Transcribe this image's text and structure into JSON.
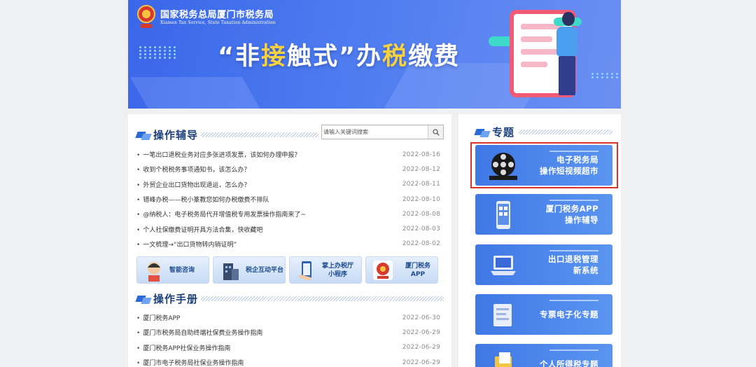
{
  "banner": {
    "org_cn": "国家税务总局厦门市税务局",
    "org_en": "Xiamen Tax Service, State Taxation Administration",
    "headline_pre": "“非",
    "headline_hl": "接",
    "headline_mid": "触式”办",
    "headline_hl2": "税",
    "headline_post": "缴费"
  },
  "guide": {
    "title": "操作辅导",
    "search_placeholder": "请输入关键词搜索",
    "items": [
      {
        "title": "一笔出口退税业务对应多张进项发票，该如何办理申报？",
        "date": "2022-08-16"
      },
      {
        "title": "收到个税税务事项通知书，该怎么办？",
        "date": "2022-08-12"
      },
      {
        "title": "外贸企业出口货物出现退运，怎么办？",
        "date": "2022-08-11"
      },
      {
        "title": "错峰办税——税小篆教您如何办税缴费不排队",
        "date": "2022-08-10"
      },
      {
        "title": "@纳税人：电子税务局代开增值税专用发票操作指南来了~",
        "date": "2022-08-08"
      },
      {
        "title": "个人社保缴费证明开具方法合集，快收藏吧",
        "date": "2022-08-03"
      },
      {
        "title": "一文梳理→“出口货物转内销证明”",
        "date": "2022-08-02"
      }
    ]
  },
  "quick_links": [
    {
      "label": "智能咨询"
    },
    {
      "label": "税企互动平台"
    },
    {
      "label": "掌上办税厅\n小程序"
    },
    {
      "label": "厦门税务APP"
    }
  ],
  "manual": {
    "title": "操作手册",
    "items": [
      {
        "title": "厦门税务APP",
        "date": "2022-06-30"
      },
      {
        "title": "厦门市税务局自助终端社保费业务操作指南",
        "date": "2022-06-29"
      },
      {
        "title": "厦门税务APP社保业务操作指南",
        "date": "2022-06-29"
      },
      {
        "title": "厦门市电子税务局社保业务操作指南",
        "date": "2022-06-29"
      }
    ]
  },
  "topics": {
    "title": "专题",
    "tiles": [
      {
        "label": "电子税务局\n操作短视频超市",
        "icon": "film-reel-icon"
      },
      {
        "label": "厦门税务APP\n操作辅导",
        "icon": "phone-icon"
      },
      {
        "label": "出口退税管理\n新系统",
        "icon": "laptop-icon"
      },
      {
        "label": "专票电子化专题",
        "icon": "invoice-icon"
      },
      {
        "label": "个人所得税专题",
        "icon": "folder-icon"
      }
    ]
  },
  "colors": {
    "accent": "#2b6bd8",
    "banner": "#4d7cf0",
    "highlight_border": "#d8342b",
    "headline_highlight": "#f7d23e"
  }
}
